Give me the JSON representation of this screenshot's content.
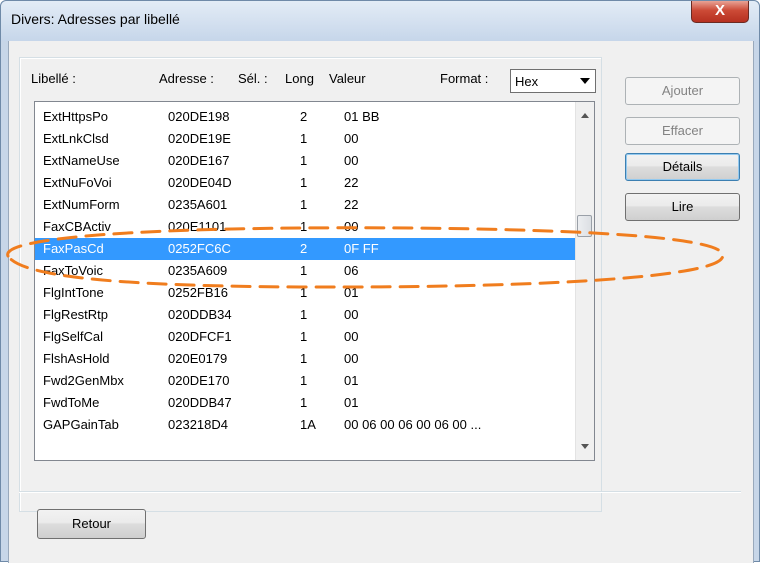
{
  "window": {
    "title": "Divers: Adresses par libellé",
    "close_icon": "close-x-icon",
    "close_glyph": "X"
  },
  "headers": {
    "label": "Libellé :",
    "address": "Adresse :",
    "sel": "Sél. :",
    "long": "Long",
    "value": "Valeur",
    "format": "Format :"
  },
  "format_select": {
    "value": "Hex",
    "icon": "chevron-down-icon"
  },
  "rows": [
    {
      "label": "ExtHttpsPo",
      "address": "020DE198",
      "long": "2",
      "value": "01  BB"
    },
    {
      "label": "ExtLnkClsd",
      "address": "020DE19E",
      "long": "1",
      "value": "00"
    },
    {
      "label": "ExtNameUse",
      "address": "020DE167",
      "long": "1",
      "value": "00"
    },
    {
      "label": "ExtNuFoVoi",
      "address": "020DE04D",
      "long": "1",
      "value": "22"
    },
    {
      "label": "ExtNumForm",
      "address": "0235A601",
      "long": "1",
      "value": "22"
    },
    {
      "label": "FaxCBActiv",
      "address": "020E1101",
      "long": "1",
      "value": "00"
    },
    {
      "label": "FaxPasCd",
      "address": "0252FC6C",
      "long": "2",
      "value": "0F  FF"
    },
    {
      "label": "FaxToVoic",
      "address": "0235A609",
      "long": "1",
      "value": "06"
    },
    {
      "label": "FlgIntTone",
      "address": "0252FB16",
      "long": "1",
      "value": "01"
    },
    {
      "label": "FlgRestRtp",
      "address": "020DDB34",
      "long": "1",
      "value": "00"
    },
    {
      "label": "FlgSelfCal",
      "address": "020DFCF1",
      "long": "1",
      "value": "00"
    },
    {
      "label": "FlshAsHold",
      "address": "020E0179",
      "long": "1",
      "value": "00"
    },
    {
      "label": "Fwd2GenMbx",
      "address": "020DE170",
      "long": "1",
      "value": "01"
    },
    {
      "label": "FwdToMe",
      "address": "020DDB47",
      "long": "1",
      "value": "01"
    },
    {
      "label": "GAPGainTab",
      "address": "023218D4",
      "long": "1A",
      "value": "00  06  00  06  00  06  00  ..."
    }
  ],
  "selected_row": 6,
  "buttons": {
    "ajouter": "Ajouter",
    "effacer": "Effacer",
    "details": "Détails",
    "lire": "Lire",
    "retour": "Retour"
  },
  "scrollbar_position": 0.38,
  "colors": {
    "selection": "#3399ff",
    "annotation": "#f07d1e"
  }
}
